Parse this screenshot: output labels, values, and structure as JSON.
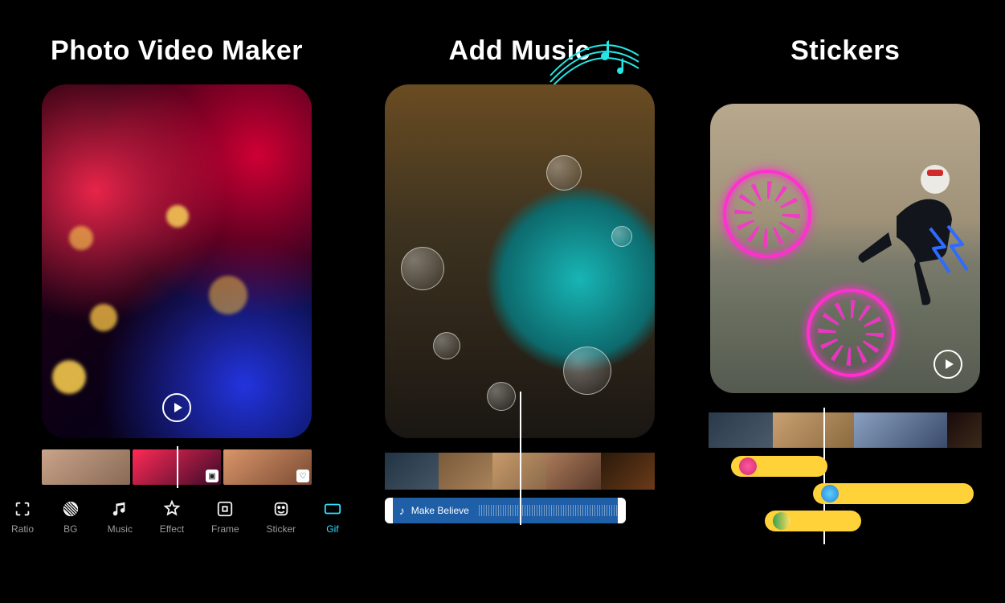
{
  "panels": [
    {
      "title": "Photo Video Maker",
      "toolbar": [
        {
          "id": "ratio",
          "label": "Ratio",
          "icon": "ratio-icon"
        },
        {
          "id": "bg",
          "label": "BG",
          "icon": "bg-icon"
        },
        {
          "id": "music",
          "label": "Music",
          "icon": "music-icon"
        },
        {
          "id": "effect",
          "label": "Effect",
          "icon": "effect-icon"
        },
        {
          "id": "frame",
          "label": "Frame",
          "icon": "frame-icon"
        },
        {
          "id": "sticker",
          "label": "Sticker",
          "icon": "sticker-icon"
        },
        {
          "id": "gif",
          "label": "Gif",
          "icon": "gif-icon"
        }
      ]
    },
    {
      "title": "Add Music",
      "track": {
        "name": "Make Believe"
      }
    },
    {
      "title": "Stickers"
    }
  ],
  "colors": {
    "accent": "#2fe0ff",
    "neon_pink": "#ff2fd0",
    "track_bg": "#1f5fa8",
    "sticker_track": "#ffd23a"
  }
}
